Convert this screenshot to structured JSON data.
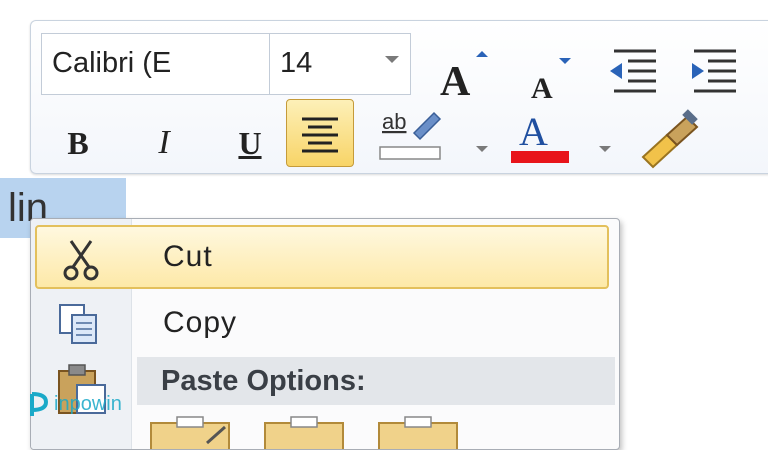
{
  "toolbar": {
    "font_name": "Calibri (E",
    "font_size": "14",
    "bold_label": "B",
    "italic_label": "I",
    "underline_label": "U",
    "grow_font_label": "A",
    "shrink_font_label": "A",
    "font_color_label": "A",
    "font_color": "#e8141a",
    "highlight_color": "#ffffff",
    "active_button_bg": "#f8d467",
    "icons": [
      "grow-font-icon",
      "shrink-font-icon",
      "decrease-indent-icon",
      "increase-indent-icon",
      "align-center-icon",
      "text-highlight-icon",
      "font-color-icon",
      "format-painter-icon"
    ]
  },
  "document": {
    "selected_text": "lin"
  },
  "context_menu": {
    "cut_label": "Cut",
    "copy_label": "Copy",
    "paste_header": "Paste Options:",
    "hover_color": "#fde9a8",
    "icons": [
      "scissors-icon",
      "copy-icon",
      "clipboard-icon",
      "paste-option-icon"
    ]
  },
  "watermark": {
    "text": "inpowin",
    "color": "#1aa9c8"
  }
}
